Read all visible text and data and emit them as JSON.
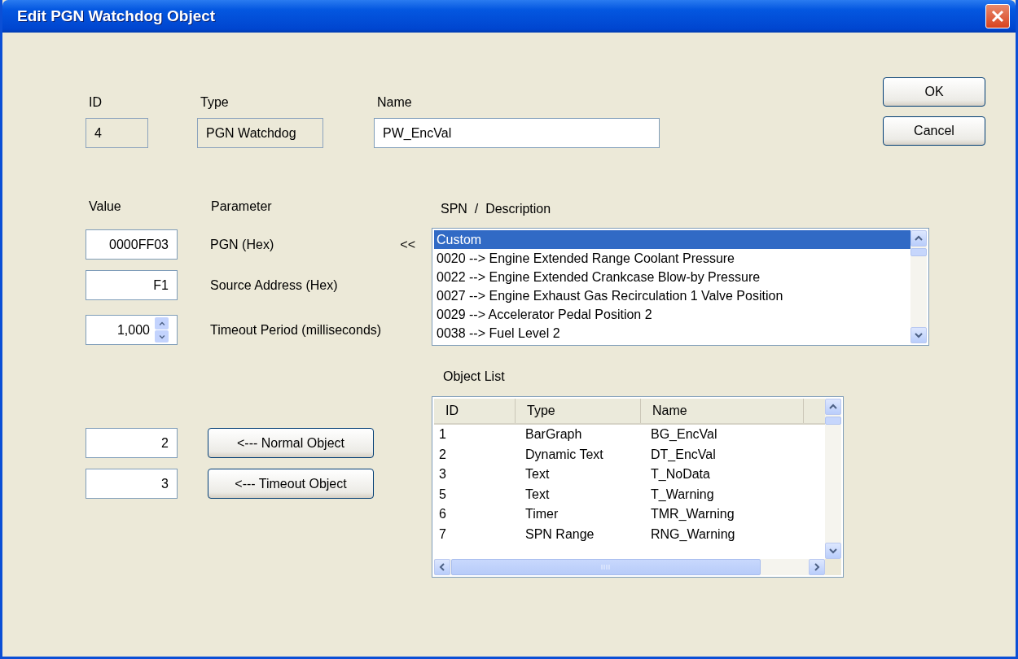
{
  "window": {
    "title": "Edit PGN Watchdog Object"
  },
  "header_fields": [
    {
      "label": "ID",
      "value": "4",
      "kind": "readonly"
    },
    {
      "label": "Type",
      "value": "PGN Watchdog",
      "kind": "readonly"
    },
    {
      "label": "Name",
      "value": "PW_EncVal",
      "kind": "edit"
    }
  ],
  "dialog_buttons": [
    "OK",
    "Cancel"
  ],
  "parameters": {
    "value_heading": "Value",
    "parameter_heading": "Parameter",
    "rows": [
      {
        "value": "0000FF03",
        "label": "PGN (Hex)",
        "marker": "<<",
        "kind": "text"
      },
      {
        "value": "F1",
        "label": "Source Address (Hex)",
        "kind": "text"
      },
      {
        "value": "1,000",
        "label": "Timeout Period (milliseconds)",
        "kind": "spin"
      }
    ]
  },
  "spn_list": {
    "heading": "SPN  /  Description",
    "items": [
      {
        "text": "Custom",
        "selected": true
      },
      {
        "text": "0020 --> Engine Extended Range Coolant Pressure",
        "selected": false
      },
      {
        "text": "0022 --> Engine Extended Crankcase Blow-by Pressure",
        "selected": false
      },
      {
        "text": "0027 --> Engine Exhaust Gas Recirculation 1 Valve Position",
        "selected": false
      },
      {
        "text": "0029 --> Accelerator Pedal Position 2",
        "selected": false
      },
      {
        "text": "0038 --> Fuel Level 2",
        "selected": false
      }
    ]
  },
  "object_links": [
    {
      "value": "2",
      "button": "<---  Normal Object"
    },
    {
      "value": "3",
      "button": "<---  Timeout Object"
    }
  ],
  "object_list": {
    "heading": "Object List",
    "columns": [
      "ID",
      "Type",
      "Name"
    ],
    "rows": [
      [
        "1",
        "BarGraph",
        "BG_EncVal"
      ],
      [
        "2",
        "Dynamic Text",
        "DT_EncVal"
      ],
      [
        "3",
        "Text",
        "T_NoData"
      ],
      [
        "5",
        "Text",
        "T_Warning"
      ],
      [
        "6",
        "Timer",
        "TMR_Warning"
      ],
      [
        "7",
        "SPN Range",
        "RNG_Warning"
      ]
    ]
  }
}
